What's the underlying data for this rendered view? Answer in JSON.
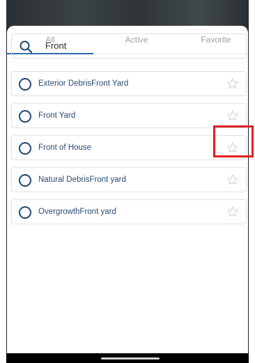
{
  "tabs": [
    {
      "label": "All",
      "selected": true
    },
    {
      "label": "Active",
      "selected": false
    },
    {
      "label": "Favorite",
      "selected": false
    }
  ],
  "search": {
    "value": "Front",
    "icon": "search-icon"
  },
  "items": [
    {
      "label": "Exterior DebrisFront Yard",
      "favorite": false
    },
    {
      "label": "Front Yard",
      "favorite": false
    },
    {
      "label": "Front of House",
      "favorite": false
    },
    {
      "label": "Natural DebrisFront yard",
      "favorite": false
    },
    {
      "label": "OvergrowthFront yard",
      "favorite": false
    }
  ],
  "colors": {
    "accent": "#2e6ab0",
    "radio": "#21476f",
    "item_text": "#2d4b72",
    "highlight": "#e02020"
  }
}
